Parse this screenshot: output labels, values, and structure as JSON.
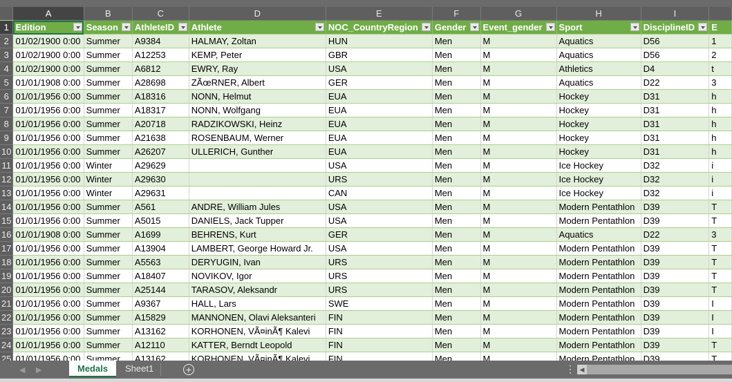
{
  "columns": [
    "A",
    "B",
    "C",
    "D",
    "E",
    "F",
    "G",
    "H",
    "I",
    ""
  ],
  "headers": [
    "Edition",
    "Season",
    "AthleteID",
    "Athlete",
    "NOC_CountryRegion",
    "Gender",
    "Event_gender",
    "Sport",
    "DisciplineID",
    "E"
  ],
  "rows": [
    [
      "01/02/1900 0:00",
      "Summer",
      "A9384",
      "HALMAY, Zoltan",
      "HUN",
      "Men",
      "M",
      "Aquatics",
      "D56",
      "1"
    ],
    [
      "01/02/1900 0:00",
      "Summer",
      "A12253",
      "KEMP, Peter",
      "GBR",
      "Men",
      "M",
      "Aquatics",
      "D56",
      "2"
    ],
    [
      "01/02/1900 0:00",
      "Summer",
      "A6812",
      "EWRY, Ray",
      "USA",
      "Men",
      "M",
      "Athletics",
      "D4",
      "t"
    ],
    [
      "01/01/1908 0:00",
      "Summer",
      "A28698",
      "ZÃœRNER, Albert",
      "GER",
      "Men",
      "M",
      "Aquatics",
      "D22",
      "3"
    ],
    [
      "01/01/1956 0:00",
      "Summer",
      "A18316",
      "NONN, Helmut",
      "EUA",
      "Men",
      "M",
      "Hockey",
      "D31",
      "h"
    ],
    [
      "01/01/1956 0:00",
      "Summer",
      "A18317",
      "NONN, Wolfgang",
      "EUA",
      "Men",
      "M",
      "Hockey",
      "D31",
      "h"
    ],
    [
      "01/01/1956 0:00",
      "Summer",
      "A20718",
      "RADZIKOWSKI, Heinz",
      "EUA",
      "Men",
      "M",
      "Hockey",
      "D31",
      "h"
    ],
    [
      "01/01/1956 0:00",
      "Summer",
      "A21638",
      "ROSENBAUM, Werner",
      "EUA",
      "Men",
      "M",
      "Hockey",
      "D31",
      "h"
    ],
    [
      "01/01/1956 0:00",
      "Summer",
      "A26207",
      "ULLERICH, Gunther",
      "EUA",
      "Men",
      "M",
      "Hockey",
      "D31",
      "h"
    ],
    [
      "01/01/1956 0:00",
      "Winter",
      "A29629",
      "",
      "USA",
      "Men",
      "M",
      "Ice Hockey",
      "D32",
      "i"
    ],
    [
      "01/01/1956 0:00",
      "Winter",
      "A29630",
      "",
      "URS",
      "Men",
      "M",
      "Ice Hockey",
      "D32",
      "i"
    ],
    [
      "01/01/1956 0:00",
      "Winter",
      "A29631",
      "",
      "CAN",
      "Men",
      "M",
      "Ice Hockey",
      "D32",
      "i"
    ],
    [
      "01/01/1956 0:00",
      "Summer",
      "A561",
      "ANDRE, William Jules",
      "USA",
      "Men",
      "M",
      "Modern Pentathlon",
      "D39",
      "T"
    ],
    [
      "01/01/1956 0:00",
      "Summer",
      "A5015",
      "DANIELS, Jack Tupper",
      "USA",
      "Men",
      "M",
      "Modern Pentathlon",
      "D39",
      "T"
    ],
    [
      "01/01/1908 0:00",
      "Summer",
      "A1699",
      "BEHRENS, Kurt",
      "GER",
      "Men",
      "M",
      "Aquatics",
      "D22",
      "3"
    ],
    [
      "01/01/1956 0:00",
      "Summer",
      "A13904",
      "LAMBERT, George Howard Jr.",
      "USA",
      "Men",
      "M",
      "Modern Pentathlon",
      "D39",
      "T"
    ],
    [
      "01/01/1956 0:00",
      "Summer",
      "A5563",
      "DERYUGIN, Ivan",
      "URS",
      "Men",
      "M",
      "Modern Pentathlon",
      "D39",
      "T"
    ],
    [
      "01/01/1956 0:00",
      "Summer",
      "A18407",
      "NOVIKOV, Igor",
      "URS",
      "Men",
      "M",
      "Modern Pentathlon",
      "D39",
      "T"
    ],
    [
      "01/01/1956 0:00",
      "Summer",
      "A25144",
      "TARASOV, Aleksandr",
      "URS",
      "Men",
      "M",
      "Modern Pentathlon",
      "D39",
      "T"
    ],
    [
      "01/01/1956 0:00",
      "Summer",
      "A9367",
      "HALL, Lars",
      "SWE",
      "Men",
      "M",
      "Modern Pentathlon",
      "D39",
      "I"
    ],
    [
      "01/01/1956 0:00",
      "Summer",
      "A15829",
      "MANNONEN, Olavi Aleksanteri",
      "FIN",
      "Men",
      "M",
      "Modern Pentathlon",
      "D39",
      "I"
    ],
    [
      "01/01/1956 0:00",
      "Summer",
      "A13162",
      "KORHONEN, VÃ¤inÃ¶ Kalevi",
      "FIN",
      "Men",
      "M",
      "Modern Pentathlon",
      "D39",
      "I"
    ],
    [
      "01/01/1956 0:00",
      "Summer",
      "A12110",
      "KATTER, Berndt Leopold",
      "FIN",
      "Men",
      "M",
      "Modern Pentathlon",
      "D39",
      "T"
    ],
    [
      "01/01/1956 0:00",
      "Summer",
      "A13162",
      "KORHONEN, VÃ¤inÃ¶ Kalevi",
      "FIN",
      "Men",
      "M",
      "Modern Pentathlon",
      "D39",
      "T"
    ]
  ],
  "sheets": {
    "tabs": [
      "Medals",
      "Sheet1"
    ],
    "active": "Medals"
  },
  "colors": {
    "header": "#70ad47",
    "band": "#e2efda",
    "active_tab": "#217346"
  },
  "icons": {
    "nav_prev": "triangle-left",
    "nav_next": "triangle-right",
    "add_sheet": "plus-circle",
    "options": "vertical-dots",
    "scroll_left": "arrow-left"
  }
}
